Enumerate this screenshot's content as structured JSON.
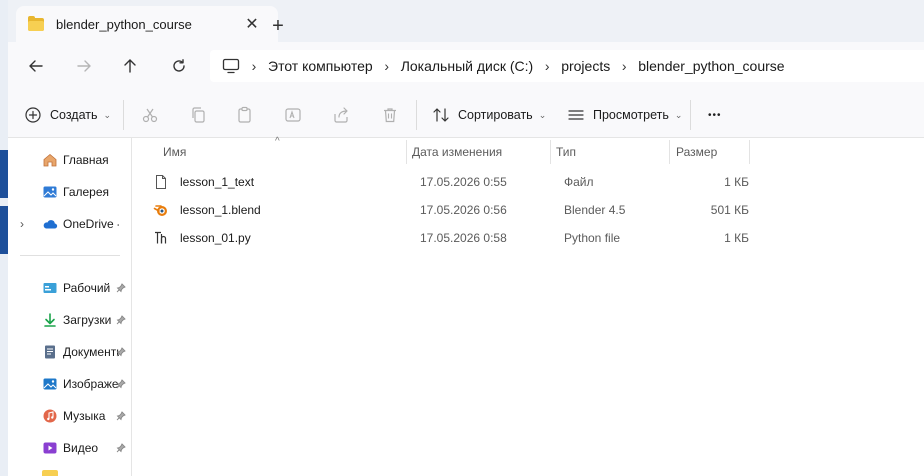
{
  "tab": {
    "title": "blender_python_course",
    "close_glyph": "✕",
    "new_tab_glyph": "+"
  },
  "address": {
    "crumbs": [
      "Этот компьютер",
      "Локальный диск (C:)",
      "projects",
      "blender_python_course"
    ],
    "separator": "›"
  },
  "toolbar": {
    "create_label": "Создать",
    "sort_label": "Сортировать",
    "view_label": "Просмотреть",
    "more_glyph": "•••",
    "chevron": "⌄"
  },
  "sidebar": {
    "items": [
      {
        "label": "Главная",
        "icon": "home-icon"
      },
      {
        "label": "Галерея",
        "icon": "gallery-icon"
      },
      {
        "label": "OneDrive - P",
        "icon": "cloud-icon",
        "expander": "›"
      },
      {
        "label": "Рабочий",
        "icon": "desktop-icon",
        "pinned": true
      },
      {
        "label": "Загрузки",
        "icon": "download-icon",
        "pinned": true
      },
      {
        "label": "Документы",
        "icon": "documents-icon",
        "pinned": true
      },
      {
        "label": "Изображения",
        "icon": "pictures-icon",
        "pinned": true
      },
      {
        "label": "Музыка",
        "icon": "music-icon",
        "pinned": true
      },
      {
        "label": "Видео",
        "icon": "video-icon",
        "pinned": true
      }
    ]
  },
  "filelist": {
    "sort_glyph": "^",
    "columns": {
      "name": "Имя",
      "date": "Дата изменения",
      "type": "Тип",
      "size": "Размер"
    },
    "rows": [
      {
        "name": "lesson_1_text",
        "date": "17.05.2026 0:55",
        "type": "Файл",
        "size": "1 КБ",
        "icon": "text-file-icon"
      },
      {
        "name": "lesson_1.blend",
        "date": "17.05.2026 0:56",
        "type": "Blender 4.5",
        "size": "501 КБ",
        "icon": "blender-file-icon"
      },
      {
        "name": "lesson_01.py",
        "date": "17.05.2026 0:58",
        "type": "Python file",
        "size": "1 КБ",
        "icon": "python-file-icon"
      }
    ]
  },
  "colors": {
    "accent": "#1d4f9a",
    "folder": "#f7cf52",
    "chrome": "#eef1f6"
  }
}
